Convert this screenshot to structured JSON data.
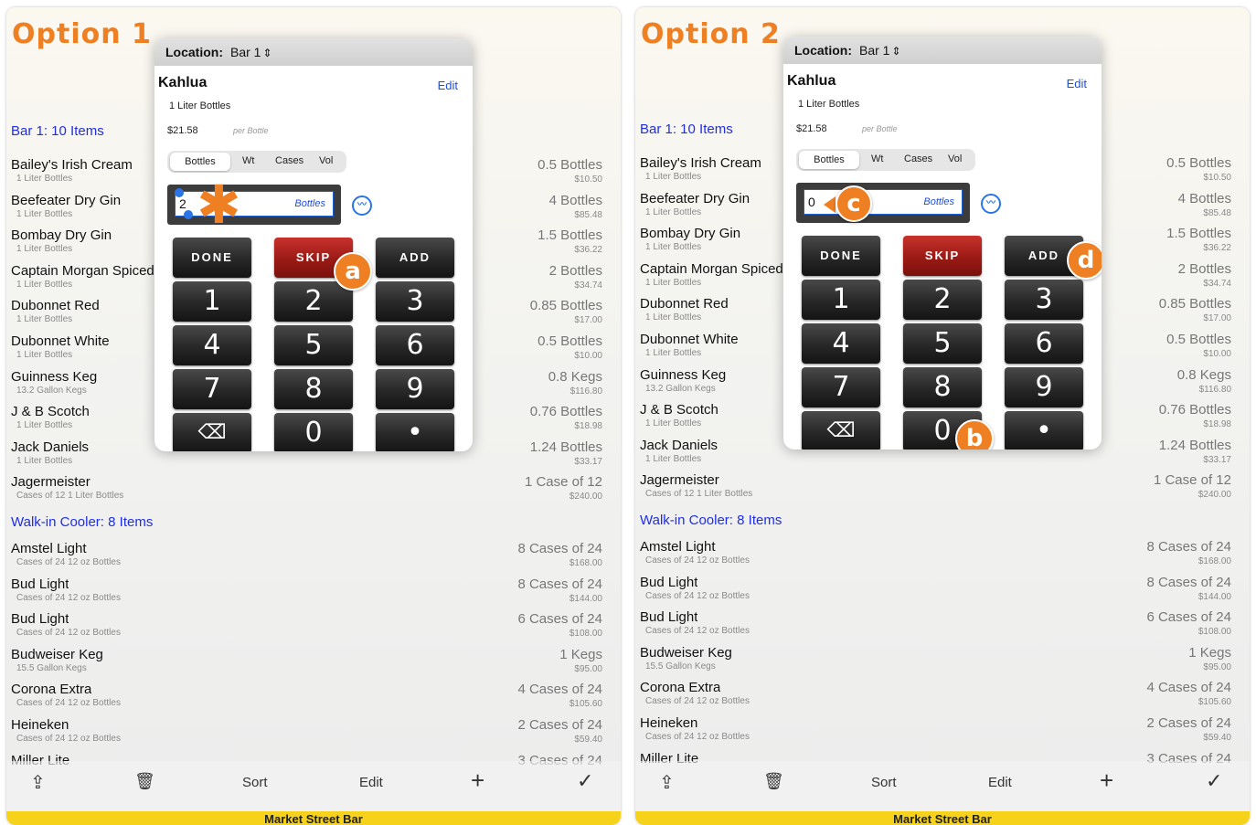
{
  "panels": [
    {
      "title": "Option 1",
      "location_label": "Location:",
      "location_value": "Bar 1",
      "item": "Kahlua",
      "edit": "Edit",
      "unit": "1 Liter Bottles",
      "price": "$21.58",
      "per": "per Bottle",
      "tabs": [
        "Bottles",
        "Wt",
        "Cases",
        "Vol"
      ],
      "entry_value": "2",
      "entry_unit": "Bottles",
      "badges": [
        "a"
      ]
    },
    {
      "title": "Option 2",
      "location_label": "Location:",
      "location_value": "Bar 1",
      "item": "Kahlua",
      "edit": "Edit",
      "unit": "1 Liter Bottles",
      "price": "$21.58",
      "per": "per Bottle",
      "tabs": [
        "Bottles",
        "Wt",
        "Cases",
        "Vol"
      ],
      "entry_value": "0",
      "entry_unit": "Bottles",
      "badges": [
        "c",
        "b",
        "d"
      ]
    }
  ],
  "keys": {
    "done": "DONE",
    "skip": "SKIP",
    "add": "ADD",
    "digits": [
      "1",
      "2",
      "3",
      "4",
      "5",
      "6",
      "7",
      "8",
      "9"
    ],
    "zero": "0",
    "dot": "•",
    "backspace": "⌫"
  },
  "section1": "Bar 1:  10 Items",
  "section2": "Walk-in Cooler:  8 Items",
  "bar_items": [
    {
      "name": "Bailey's Irish Cream",
      "sub": "1 Liter Bottles",
      "qty": "0.5 Bottles",
      "price": "$10.50"
    },
    {
      "name": "Beefeater Dry Gin",
      "sub": "1 Liter Bottles",
      "qty": "4 Bottles",
      "price": "$85.48"
    },
    {
      "name": "Bombay Dry Gin",
      "sub": "1 Liter Bottles",
      "qty": "1.5 Bottles",
      "price": "$36.22"
    },
    {
      "name": "Captain Morgan Spiced",
      "sub": "1 Liter Bottles",
      "qty": "2 Bottles",
      "price": "$34.74"
    },
    {
      "name": "Dubonnet Red",
      "sub": "1 Liter Bottles",
      "qty": "0.85 Bottles",
      "price": "$17.00"
    },
    {
      "name": "Dubonnet White",
      "sub": "1 Liter Bottles",
      "qty": "0.5 Bottles",
      "price": "$10.00"
    },
    {
      "name": "Guinness Keg",
      "sub": "13.2 Gallon Kegs",
      "qty": "0.8 Kegs",
      "price": "$116.80"
    },
    {
      "name": "J & B Scotch",
      "sub": "1 Liter Bottles",
      "qty": "0.76 Bottles",
      "price": "$18.98"
    },
    {
      "name": "Jack Daniels",
      "sub": "1 Liter Bottles",
      "qty": "1.24 Bottles",
      "price": "$33.17"
    },
    {
      "name": "Jagermeister",
      "sub": "Cases of 12 1 Liter Bottles",
      "qty": "1 Case of 12",
      "price": "$240.00"
    }
  ],
  "cooler_items": [
    {
      "name": "Amstel Light",
      "sub": "Cases of 24 12 oz Bottles",
      "qty": "8 Cases of 24",
      "price": "$168.00"
    },
    {
      "name": "Bud Light",
      "sub": "Cases of 24 12 oz Bottles",
      "qty": "8 Cases of 24",
      "price": "$144.00"
    },
    {
      "name": "Bud Light",
      "sub": "Cases of 24 12 oz Bottles",
      "qty": "6 Cases of 24",
      "price": "$108.00"
    },
    {
      "name": "Budweiser Keg",
      "sub": "15.5 Gallon Kegs",
      "qty": "1 Kegs",
      "price": "$95.00"
    },
    {
      "name": "Corona Extra",
      "sub": "Cases of 24 12 oz Bottles",
      "qty": "4 Cases of 24",
      "price": "$105.60"
    },
    {
      "name": "Heineken",
      "sub": "Cases of 24 12 oz Bottles",
      "qty": "2 Cases of 24",
      "price": "$59.40"
    },
    {
      "name": "Miller Lite",
      "sub": "",
      "qty": "3 Cases of 24",
      "price": ""
    }
  ],
  "toolbar": {
    "share": "⇪",
    "trash": "🗑",
    "sort": "Sort",
    "edit": "Edit",
    "add": "+",
    "check": "✓"
  },
  "footer": "Market Street Bar",
  "colors": {
    "accent": "#ee7f22",
    "link": "#1f2ee8",
    "footer": "#f6d21b",
    "skip": "#9a1a15"
  }
}
